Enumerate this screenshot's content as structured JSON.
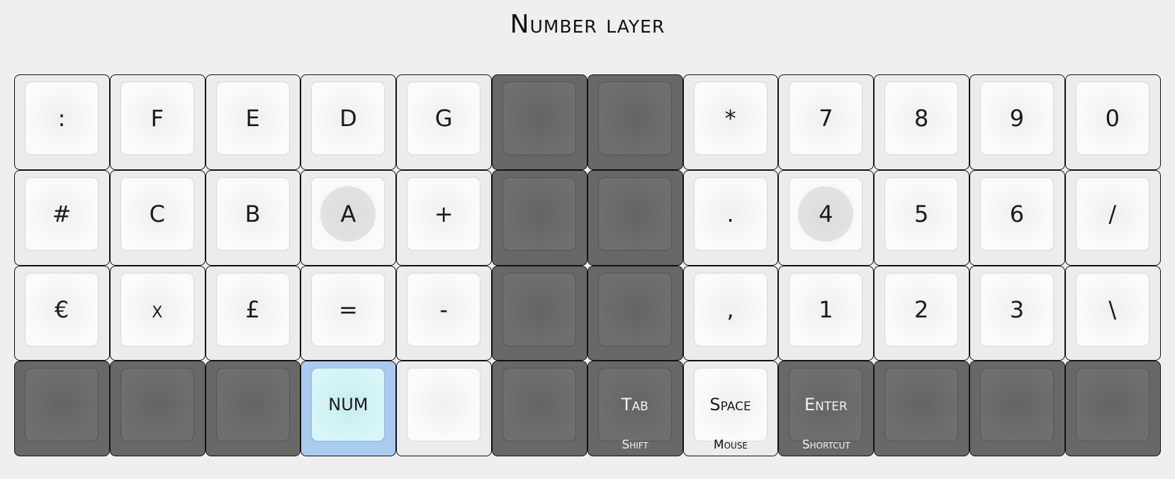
{
  "title": "Number layer",
  "rows": [
    [
      {
        "label": ":",
        "style": "light"
      },
      {
        "label": "F",
        "style": "light"
      },
      {
        "label": "E",
        "style": "light"
      },
      {
        "label": "D",
        "style": "light"
      },
      {
        "label": "G",
        "style": "light"
      },
      {
        "label": "",
        "style": "dark"
      },
      {
        "label": "",
        "style": "dark"
      },
      {
        "label": "*",
        "style": "light"
      },
      {
        "label": "7",
        "style": "light"
      },
      {
        "label": "8",
        "style": "light"
      },
      {
        "label": "9",
        "style": "light"
      },
      {
        "label": "0",
        "style": "light"
      }
    ],
    [
      {
        "label": "#",
        "style": "light"
      },
      {
        "label": "C",
        "style": "light"
      },
      {
        "label": "B",
        "style": "light"
      },
      {
        "label": "A",
        "style": "light",
        "homing": true
      },
      {
        "label": "+",
        "style": "light"
      },
      {
        "label": "",
        "style": "dark"
      },
      {
        "label": "",
        "style": "dark"
      },
      {
        "label": ".",
        "style": "light"
      },
      {
        "label": "4",
        "style": "light",
        "homing": true
      },
      {
        "label": "5",
        "style": "light"
      },
      {
        "label": "6",
        "style": "light"
      },
      {
        "label": "/",
        "style": "light"
      }
    ],
    [
      {
        "label": "€",
        "style": "light"
      },
      {
        "label": "x",
        "style": "light"
      },
      {
        "label": "£",
        "style": "light"
      },
      {
        "label": "=",
        "style": "light"
      },
      {
        "label": "-",
        "style": "light"
      },
      {
        "label": "",
        "style": "dark"
      },
      {
        "label": "",
        "style": "dark"
      },
      {
        "label": ",",
        "style": "light"
      },
      {
        "label": "1",
        "style": "light"
      },
      {
        "label": "2",
        "style": "light"
      },
      {
        "label": "3",
        "style": "light"
      },
      {
        "label": "\\",
        "style": "light"
      }
    ],
    [
      {
        "label": "",
        "style": "dark"
      },
      {
        "label": "",
        "style": "dark"
      },
      {
        "label": "",
        "style": "dark"
      },
      {
        "label": "NUM",
        "style": "held",
        "small": true
      },
      {
        "label": "",
        "style": "light"
      },
      {
        "label": "",
        "style": "dark"
      },
      {
        "label": "Tab",
        "hold": "Shift",
        "style": "dark",
        "small": true
      },
      {
        "label": "Space",
        "hold": "Mouse",
        "style": "light",
        "small": true
      },
      {
        "label": "Enter",
        "hold": "Shortcut",
        "style": "dark",
        "small": true
      },
      {
        "label": "",
        "style": "dark"
      },
      {
        "label": "",
        "style": "dark"
      },
      {
        "label": "",
        "style": "dark"
      }
    ]
  ],
  "colors": {
    "background": "#efefef",
    "light_key": "#ececec",
    "dark_key": "#686868",
    "held_key": "#a9cbf0",
    "held_cap": "#d8f6f7"
  }
}
